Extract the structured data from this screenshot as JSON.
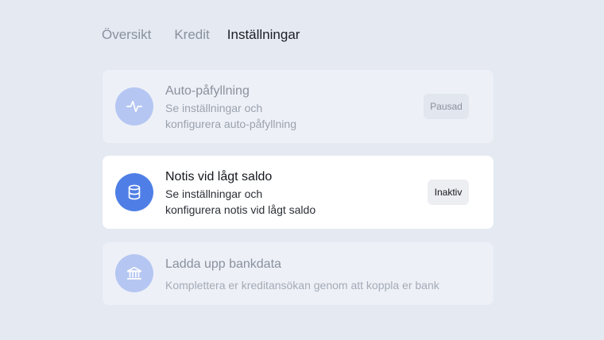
{
  "tabs": [
    {
      "label": "Översikt",
      "active": false
    },
    {
      "label": "Kredit",
      "active": false
    },
    {
      "label": "Inställningar",
      "active": true
    }
  ],
  "cards": [
    {
      "title": "Auto-påfyllning",
      "desc_line1": "Se inställningar och",
      "desc_line2": "konfigurera auto-påfyllning",
      "badge": "Pausad",
      "icon": "activity-icon",
      "state": "disabled"
    },
    {
      "title": "Notis vid lågt saldo",
      "desc_line1": "Se inställningar och",
      "desc_line2": "konfigurera notis vid lågt saldo",
      "badge": "Inaktiv",
      "icon": "database-icon",
      "state": "enabled"
    },
    {
      "title": "Ladda upp bankdata",
      "desc_line1": "Komplettera er kreditansökan genom att koppla er bank",
      "icon": "bank-icon",
      "state": "disabled"
    }
  ],
  "colors": {
    "background": "#e4e9f2",
    "accent": "#4f7fe6",
    "accent_muted": "#b5c6f2"
  }
}
